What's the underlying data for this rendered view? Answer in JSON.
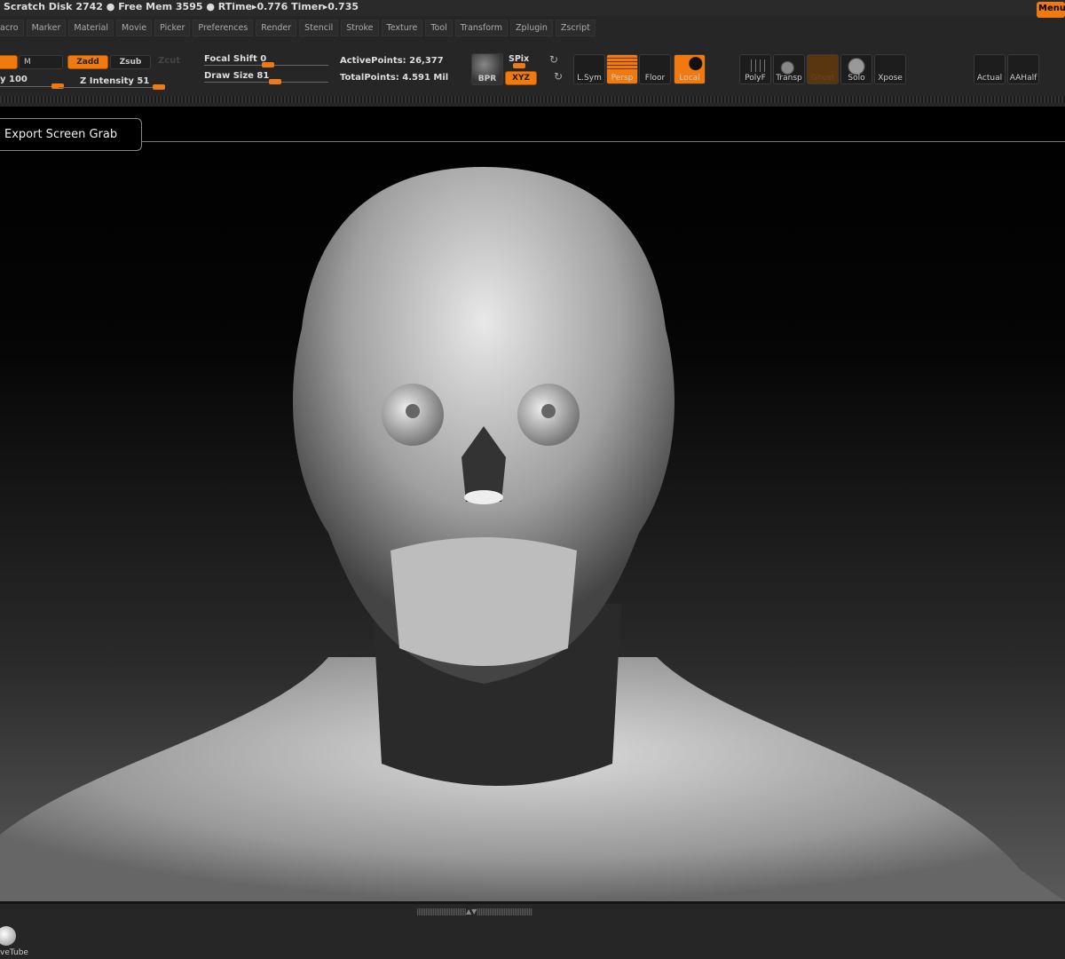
{
  "status": {
    "text": "Scratch Disk 2742 ● Free Mem 3595 ● RTime▸0.776  Timer▸0.735"
  },
  "menu_button": "Menu",
  "menus": [
    "acro",
    "Marker",
    "Material",
    "Movie",
    "Picker",
    "Preferences",
    "Render",
    "Stencil",
    "Stroke",
    "Texture",
    "Tool",
    "Transform",
    "Zplugin",
    "Zscript"
  ],
  "toolbar": {
    "m": "M",
    "zadd": "Zadd",
    "zsub": "Zsub",
    "zcut": "Zcut",
    "intensity": "y 100",
    "z_intensity": "Z Intensity 51",
    "focal_shift": "Focal Shift 0",
    "draw_size": "Draw Size 81",
    "active_points": "ActivePoints: 26,377",
    "total_points": "TotalPoints: 4.591 Mil",
    "bpr": "BPR",
    "spix": "SPix",
    "xyz": "XYZ",
    "lsym": "L.Sym",
    "persp": "Persp",
    "floor": "Floor",
    "local": "Local",
    "polyf": "PolyF",
    "transp": "Transp",
    "ghost": "Ghost",
    "solo": "Solo",
    "xpose": "Xpose",
    "actual": "Actual",
    "aahalf": "AAHalf"
  },
  "tooltip": "Export Screen Grab",
  "bottom": {
    "tray_item": "veTube"
  },
  "colors": {
    "accent": "#f07a10"
  }
}
